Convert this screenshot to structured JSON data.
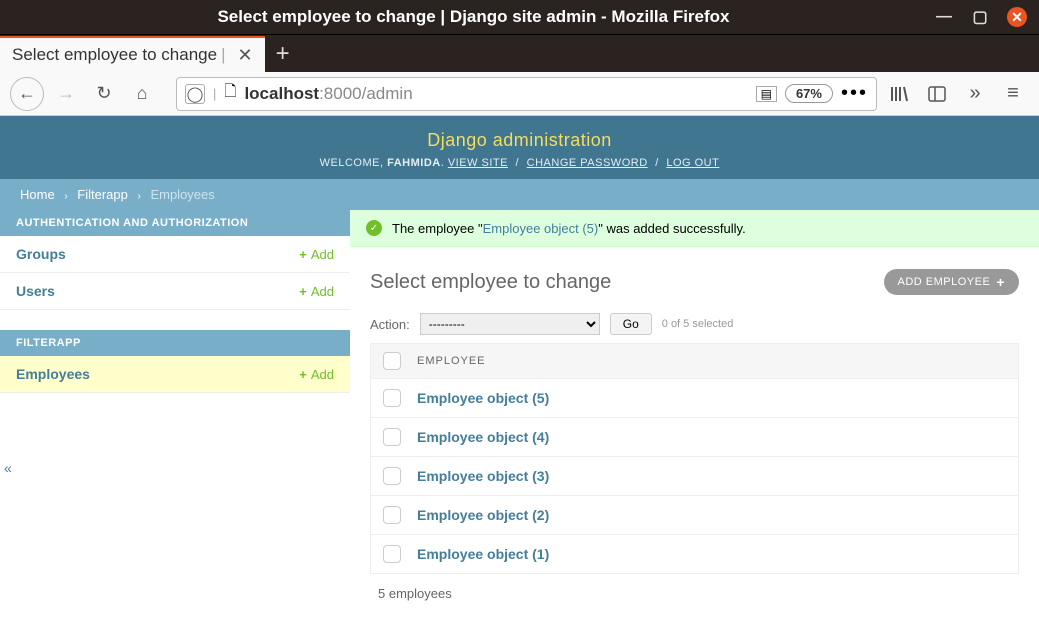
{
  "window": {
    "title": "Select employee to change | Django site admin - Mozilla Firefox"
  },
  "tab": {
    "label": "Select employee to change"
  },
  "urlbar": {
    "host_bold": "localhost",
    "rest": ":8000/admin",
    "zoom": "67%"
  },
  "header": {
    "title": "Django administration",
    "welcome": "WELCOME,",
    "username": "FAHMIDA",
    "view_site": "VIEW SITE",
    "change_password": "CHANGE PASSWORD",
    "log_out": "LOG OUT"
  },
  "breadcrumbs": {
    "home": "Home",
    "app": "Filterapp",
    "model": "Employees"
  },
  "sidebar": {
    "apps": [
      {
        "header": "AUTHENTICATION AND AUTHORIZATION",
        "models": [
          {
            "name": "Groups",
            "add": "Add",
            "highlight": false
          },
          {
            "name": "Users",
            "add": "Add",
            "highlight": false
          }
        ]
      },
      {
        "header": "FILTERAPP",
        "models": [
          {
            "name": "Employees",
            "add": "Add",
            "highlight": true
          }
        ]
      }
    ]
  },
  "message": {
    "pre": "The employee \"",
    "object": "Employee object (5)",
    "post": "\" was added successfully."
  },
  "content": {
    "title": "Select employee to change",
    "add_button": "ADD EMPLOYEE",
    "add_button_plus": "+",
    "action_label": "Action:",
    "action_placeholder": "---------",
    "go": "Go",
    "selection_text": "0 of 5 selected",
    "column_header": "EMPLOYEE",
    "rows": [
      "Employee object (5)",
      "Employee object (4)",
      "Employee object (3)",
      "Employee object (2)",
      "Employee object (1)"
    ],
    "count_text": "5 employees"
  }
}
